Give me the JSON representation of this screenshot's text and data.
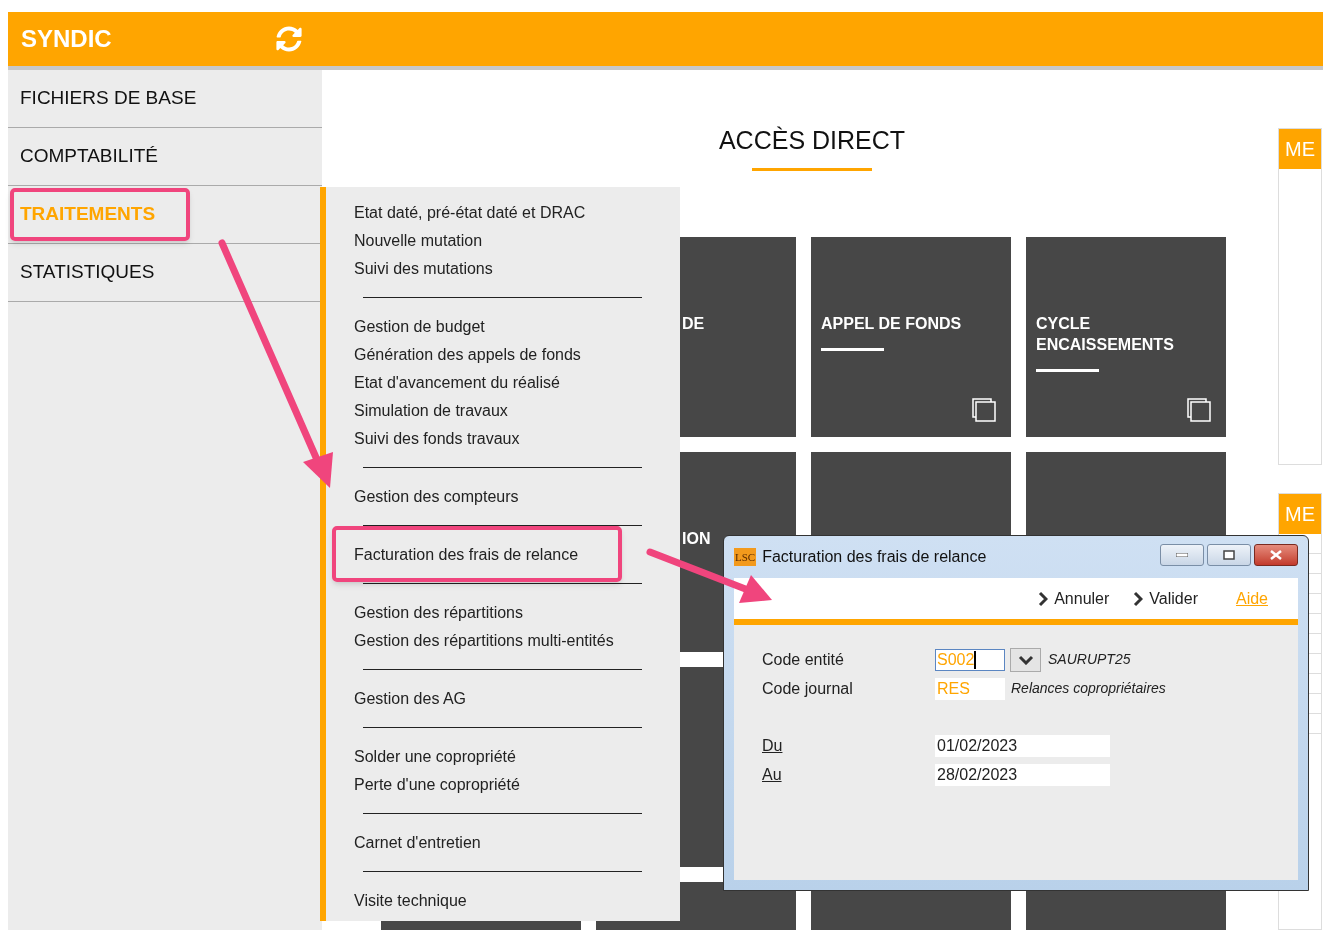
{
  "app": {
    "title": "SYNDIC"
  },
  "sidebar": {
    "items": [
      {
        "label": "FICHIERS DE BASE",
        "selected": false,
        "annotated": false
      },
      {
        "label": "COMPTABILITÉ",
        "selected": false,
        "annotated": false
      },
      {
        "label": "TRAITEMENTS",
        "selected": true,
        "annotated": true
      },
      {
        "label": "STATISTIQUES",
        "selected": false,
        "annotated": false
      }
    ]
  },
  "main": {
    "title": "ACCÈS DIRECT",
    "tiles": [
      {
        "kind": "partial",
        "title": "DE"
      },
      {
        "kind": "titled",
        "title": "APPEL DE FONDS"
      },
      {
        "kind": "titled",
        "title": "CYCLE ENCAISSEMENTS"
      },
      {
        "kind": "partial",
        "title": "ION"
      },
      {
        "kind": "empty"
      },
      {
        "kind": "empty"
      },
      {
        "kind": "empty"
      },
      {
        "kind": "empty"
      },
      {
        "kind": "empty"
      },
      {
        "kind": "empty"
      },
      {
        "kind": "empty"
      }
    ],
    "side_panels": [
      {
        "title": "ME"
      },
      {
        "title": "ME"
      }
    ]
  },
  "dropdown_menu": {
    "groups": [
      [
        {
          "label": "Etat daté, pré-état daté et DRAC",
          "annotated": false
        },
        {
          "label": "Nouvelle mutation",
          "annotated": false
        },
        {
          "label": "Suivi des mutations",
          "annotated": false
        }
      ],
      [
        {
          "label": "Gestion de budget",
          "annotated": false
        },
        {
          "label": "Génération des appels de fonds",
          "annotated": false
        },
        {
          "label": "Etat d'avancement du réalisé",
          "annotated": false
        },
        {
          "label": "Simulation de travaux",
          "annotated": false
        },
        {
          "label": "Suivi des fonds travaux",
          "annotated": false
        }
      ],
      [
        {
          "label": "Gestion des compteurs",
          "annotated": false
        }
      ],
      [
        {
          "label": "Facturation des frais de relance",
          "annotated": true
        }
      ],
      [
        {
          "label": "Gestion des répartitions",
          "annotated": false
        },
        {
          "label": "Gestion des répartitions multi-entités",
          "annotated": false
        }
      ],
      [
        {
          "label": "Gestion des AG",
          "annotated": false
        }
      ],
      [
        {
          "label": "Solder une copropriété",
          "annotated": false
        },
        {
          "label": "Perte d'une copropriété",
          "annotated": false
        }
      ],
      [
        {
          "label": "Carnet d'entretien",
          "annotated": false
        }
      ],
      [
        {
          "label": "Visite technique",
          "annotated": false
        }
      ]
    ]
  },
  "dialog": {
    "title": "Facturation des frais de relance",
    "app_icon": "LSC",
    "actions": [
      {
        "label": "Annuler",
        "kind": "button"
      },
      {
        "label": "Valider",
        "kind": "button"
      },
      {
        "label": "Aide",
        "kind": "link"
      }
    ],
    "fields": [
      {
        "label": "Code entité",
        "value": "S002",
        "kind": "code_dropdown",
        "description": "SAURUPT25",
        "focused": true,
        "underlined": false
      },
      {
        "label": "Code journal",
        "value": "RES",
        "kind": "code",
        "description": "Relances copropriétaires",
        "focused": false,
        "underlined": false
      },
      {
        "label": "Du",
        "value": "01/02/2023",
        "kind": "date",
        "focused": false,
        "underlined": true
      },
      {
        "label": "Au",
        "value": "28/02/2023",
        "kind": "date",
        "focused": false,
        "underlined": true
      }
    ]
  }
}
